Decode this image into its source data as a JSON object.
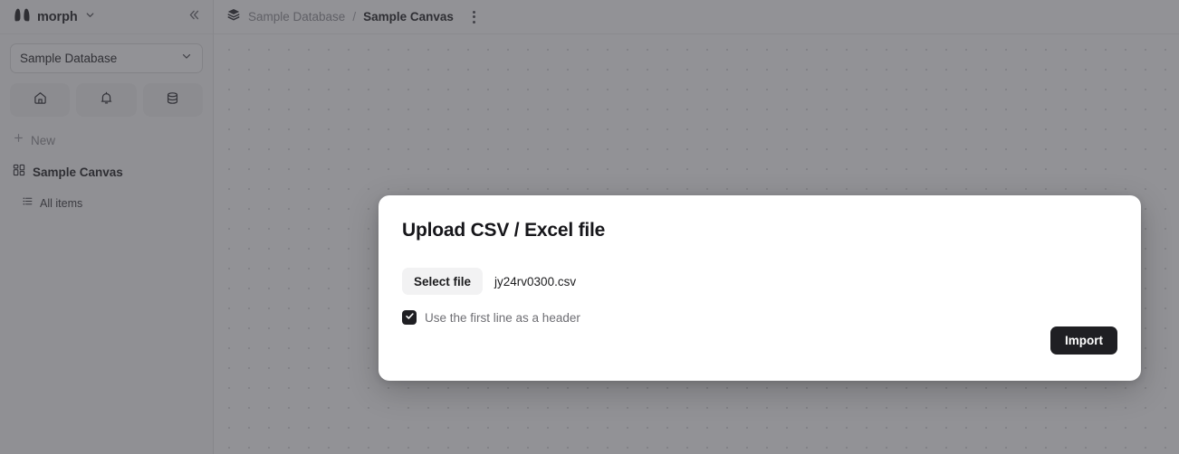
{
  "sidebar": {
    "brand": {
      "name": "morph",
      "logo_icon": "morph-logo-icon",
      "chevron_icon": "chevron-down-icon"
    },
    "collapse_icon": "chevrons-left-icon",
    "database_select": {
      "value": "Sample Database",
      "chevron_icon": "chevron-down-icon"
    },
    "icon_buttons": [
      {
        "name": "home",
        "icon": "home-icon"
      },
      {
        "name": "notifications",
        "icon": "bell-icon"
      },
      {
        "name": "database",
        "icon": "database-icon"
      }
    ],
    "new_button": {
      "label": "New",
      "icon": "plus-icon"
    },
    "nav_items": [
      {
        "label": "Sample Canvas",
        "icon": "grid-dashboard-icon",
        "active": true
      }
    ],
    "sub_items": [
      {
        "label": "All items",
        "icon": "list-icon"
      }
    ]
  },
  "topbar": {
    "workspace_icon": "layers-stack-icon",
    "breadcrumb": {
      "parent": "Sample Database",
      "separator": "/",
      "current": "Sample Canvas"
    },
    "more_menu_icon": "kebab-menu-icon"
  },
  "modal": {
    "title": "Upload CSV / Excel file",
    "select_file_label": "Select file",
    "file_name": "jy24rv0300.csv",
    "header_checkbox": {
      "label": "Use the first line as a header",
      "checked": true,
      "check_icon": "checkmark-icon"
    },
    "import_label": "Import"
  },
  "colors": {
    "accent_dark": "#1f1f23",
    "scrim": "rgba(60,60,67,0.56)",
    "sidebar_bg": "#fbfbfb",
    "button_light": "#f2f2f3"
  }
}
